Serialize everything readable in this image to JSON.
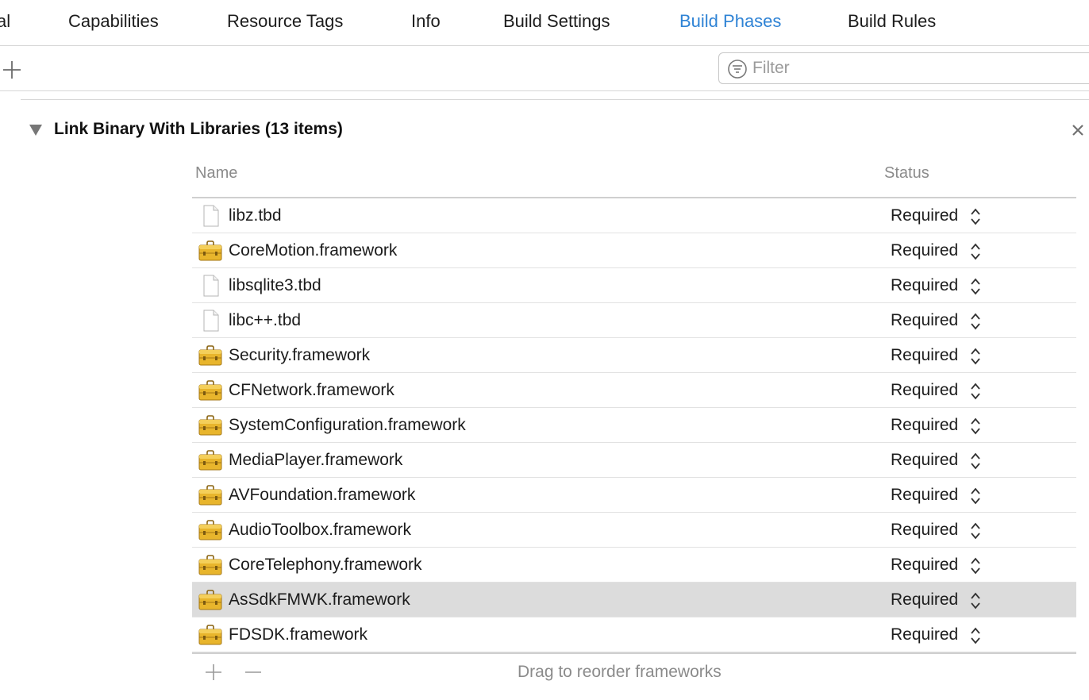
{
  "tabs": [
    {
      "label": "al",
      "active": false
    },
    {
      "label": "Capabilities",
      "active": false
    },
    {
      "label": "Resource Tags",
      "active": false
    },
    {
      "label": "Info",
      "active": false
    },
    {
      "label": "Build Settings",
      "active": false
    },
    {
      "label": "Build Phases",
      "active": true
    },
    {
      "label": "Build Rules",
      "active": false
    }
  ],
  "toolbar": {
    "filter_placeholder": "Filter"
  },
  "section": {
    "title": "Link Binary With Libraries (13 items)",
    "columns": {
      "name": "Name",
      "status": "Status"
    },
    "rows": [
      {
        "name": "libz.tbd",
        "icon": "file-icon",
        "status": "Required",
        "selected": false
      },
      {
        "name": "CoreMotion.framework",
        "icon": "toolbox-icon",
        "status": "Required",
        "selected": false
      },
      {
        "name": "libsqlite3.tbd",
        "icon": "file-icon",
        "status": "Required",
        "selected": false
      },
      {
        "name": "libc++.tbd",
        "icon": "file-icon",
        "status": "Required",
        "selected": false
      },
      {
        "name": "Security.framework",
        "icon": "toolbox-icon",
        "status": "Required",
        "selected": false
      },
      {
        "name": "CFNetwork.framework",
        "icon": "toolbox-icon",
        "status": "Required",
        "selected": false
      },
      {
        "name": "SystemConfiguration.framework",
        "icon": "toolbox-icon",
        "status": "Required",
        "selected": false
      },
      {
        "name": "MediaPlayer.framework",
        "icon": "toolbox-icon",
        "status": "Required",
        "selected": false
      },
      {
        "name": "AVFoundation.framework",
        "icon": "toolbox-icon",
        "status": "Required",
        "selected": false
      },
      {
        "name": "AudioToolbox.framework",
        "icon": "toolbox-icon",
        "status": "Required",
        "selected": false
      },
      {
        "name": "CoreTelephony.framework",
        "icon": "toolbox-icon",
        "status": "Required",
        "selected": false
      },
      {
        "name": "AsSdkFMWK.framework",
        "icon": "toolbox-icon",
        "status": "Required",
        "selected": true
      },
      {
        "name": "FDSDK.framework",
        "icon": "toolbox-icon",
        "status": "Required",
        "selected": false
      }
    ],
    "footer_hint": "Drag to reorder frameworks"
  },
  "colors": {
    "accent": "#2f83d5",
    "selected_row": "#dcdcdc",
    "toolbox_gold": "#e8b52c"
  }
}
